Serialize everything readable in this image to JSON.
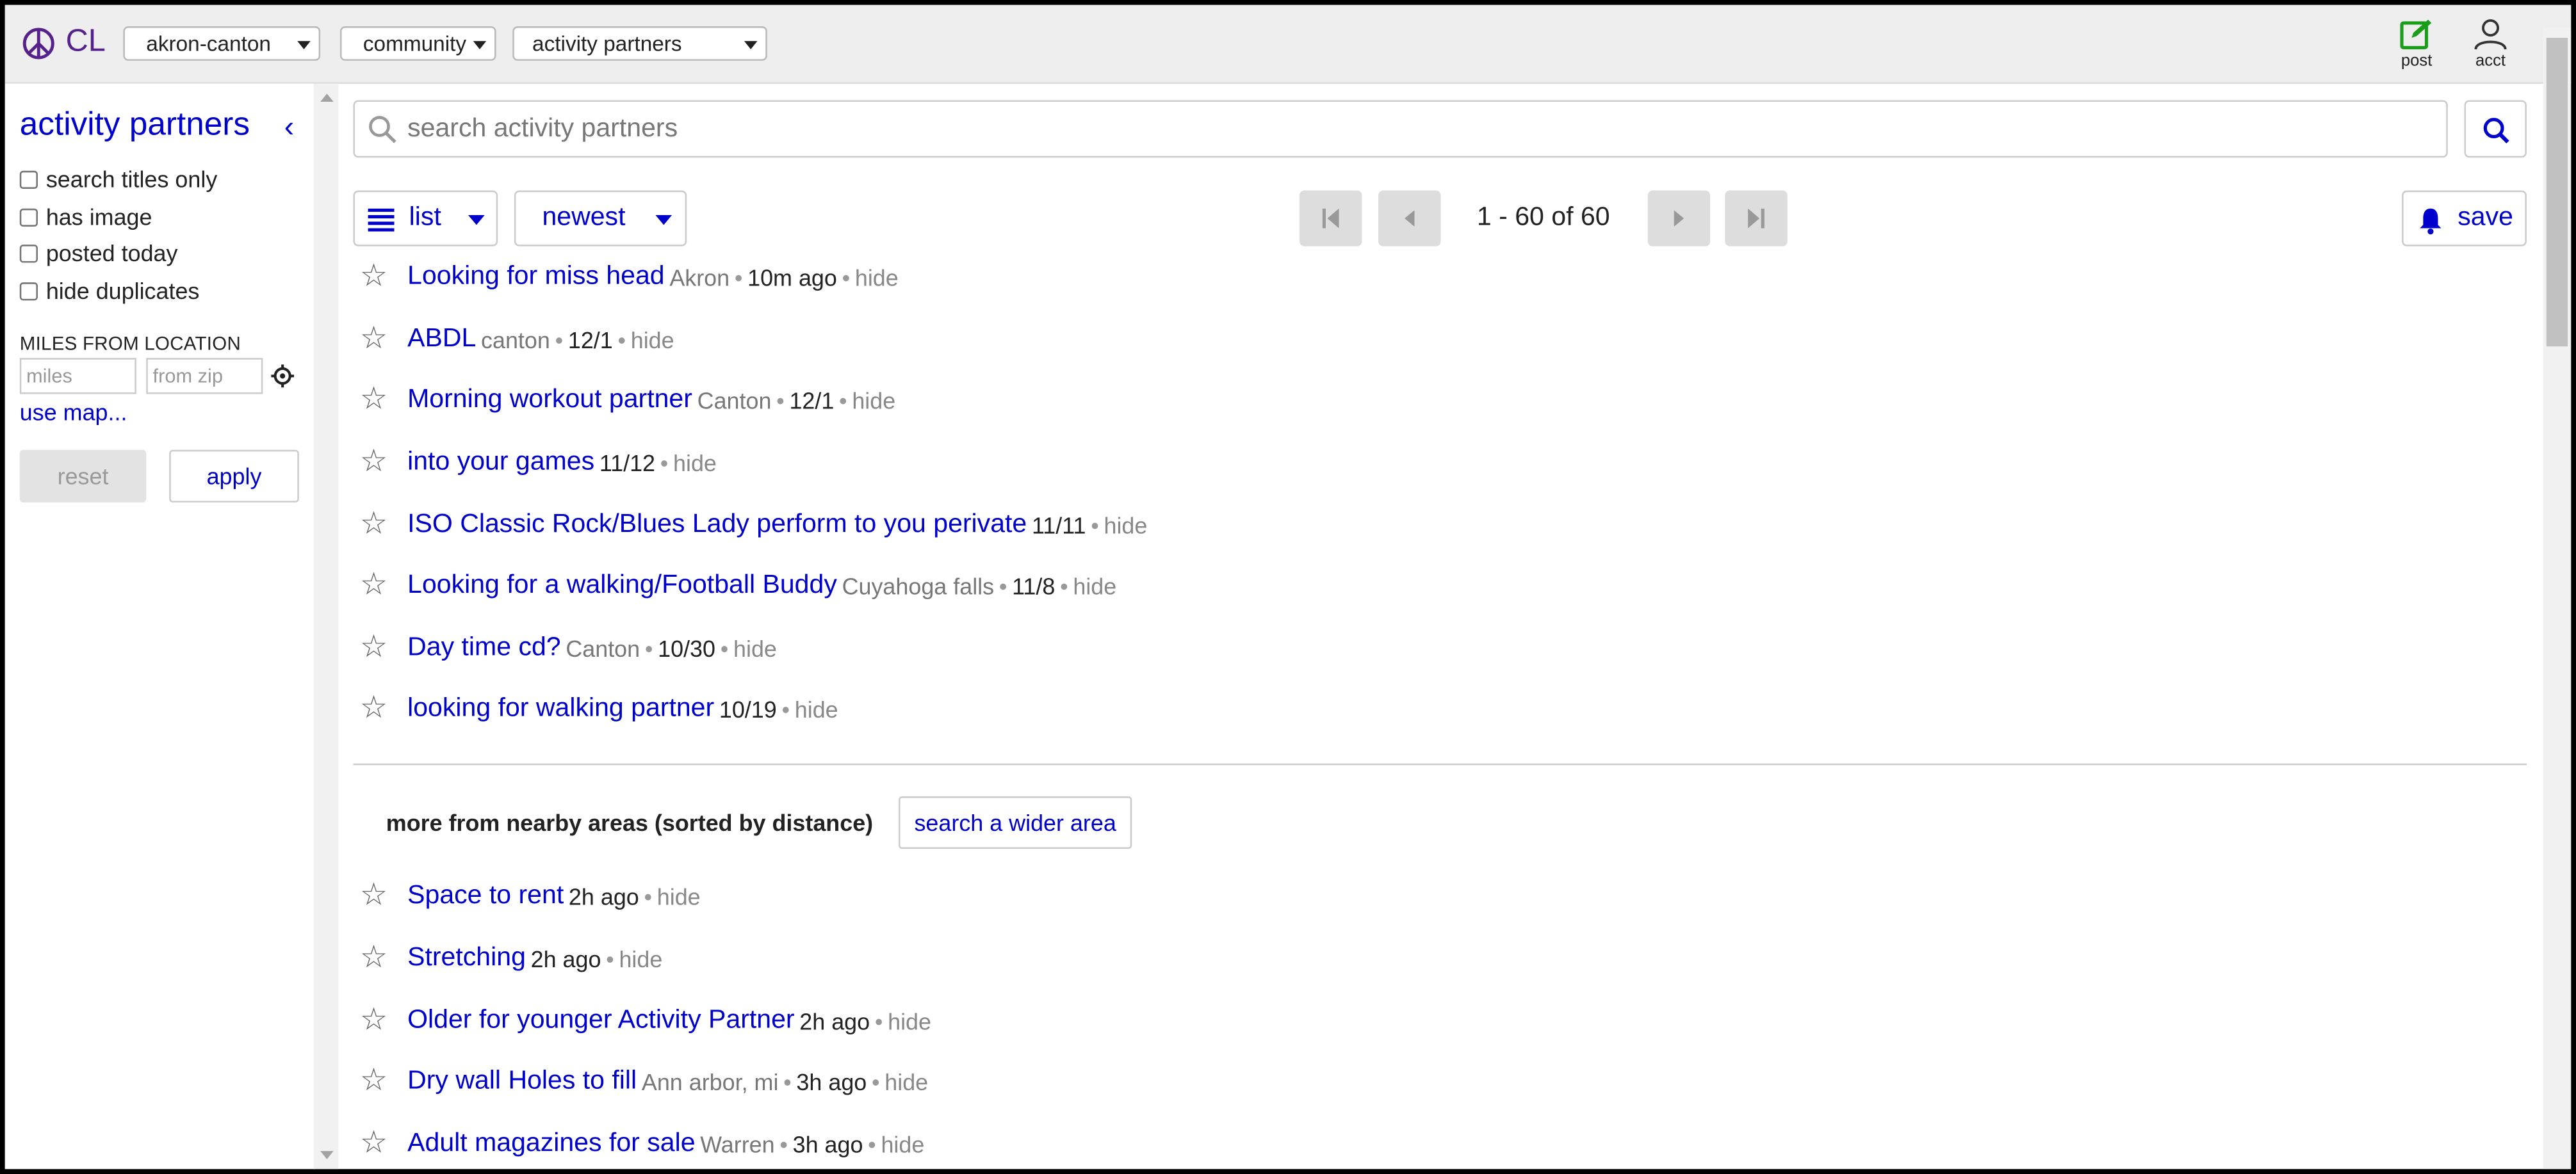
{
  "header": {
    "logo_text": "CL",
    "region": "akron-canton",
    "section": "community",
    "category": "activity partners",
    "post_label": "post",
    "acct_label": "acct"
  },
  "sidebar": {
    "title": "activity partners",
    "filters": [
      {
        "label": "search titles only",
        "checked": false
      },
      {
        "label": "has image",
        "checked": false
      },
      {
        "label": "posted today",
        "checked": false
      },
      {
        "label": "hide duplicates",
        "checked": false
      }
    ],
    "miles_label": "MILES FROM LOCATION",
    "miles_placeholder": "miles",
    "zip_placeholder": "from zip",
    "use_map": "use map...",
    "reset": "reset",
    "apply": "apply"
  },
  "search": {
    "placeholder": "search activity partners"
  },
  "toolbar": {
    "view_mode": "list",
    "sort": "newest",
    "pagination": "1 - 60 of 60",
    "save": "save"
  },
  "listings": [
    {
      "title": "Looking for miss head",
      "location": "Akron",
      "date": "10m ago",
      "hide": "hide"
    },
    {
      "title": "ABDL",
      "location": "canton",
      "date": "12/1",
      "hide": "hide"
    },
    {
      "title": "Morning workout partner",
      "location": "Canton",
      "date": "12/1",
      "hide": "hide"
    },
    {
      "title": "into your games",
      "location": "",
      "date": "11/12",
      "hide": "hide"
    },
    {
      "title": "ISO Classic Rock/Blues Lady perform to you perivate",
      "location": "",
      "date": "11/11",
      "hide": "hide"
    },
    {
      "title": "Looking for a walking/Football Buddy",
      "location": "Cuyahoga falls",
      "date": "11/8",
      "hide": "hide"
    },
    {
      "title": "Day time cd?",
      "location": "Canton",
      "date": "10/30",
      "hide": "hide"
    },
    {
      "title": "looking for walking partner",
      "location": "",
      "date": "10/19",
      "hide": "hide"
    }
  ],
  "nearby": {
    "label": "more from nearby areas (sorted by distance)",
    "wider_button": "search a wider area",
    "listings": [
      {
        "title": "Space to rent",
        "location": "",
        "date": "2h ago",
        "hide": "hide"
      },
      {
        "title": "Stretching",
        "location": "",
        "date": "2h ago",
        "hide": "hide"
      },
      {
        "title": "Older for younger Activity Partner",
        "location": "",
        "date": "2h ago",
        "hide": "hide"
      },
      {
        "title": "Dry wall Holes to fill",
        "location": "Ann arbor, mi",
        "date": "3h ago",
        "hide": "hide"
      },
      {
        "title": "Adult magazines for sale",
        "location": "Warren",
        "date": "3h ago",
        "hide": "hide"
      }
    ]
  },
  "colors": {
    "link": "#0000cc",
    "brand": "#55228b",
    "post_icon": "#1a9e1a"
  }
}
